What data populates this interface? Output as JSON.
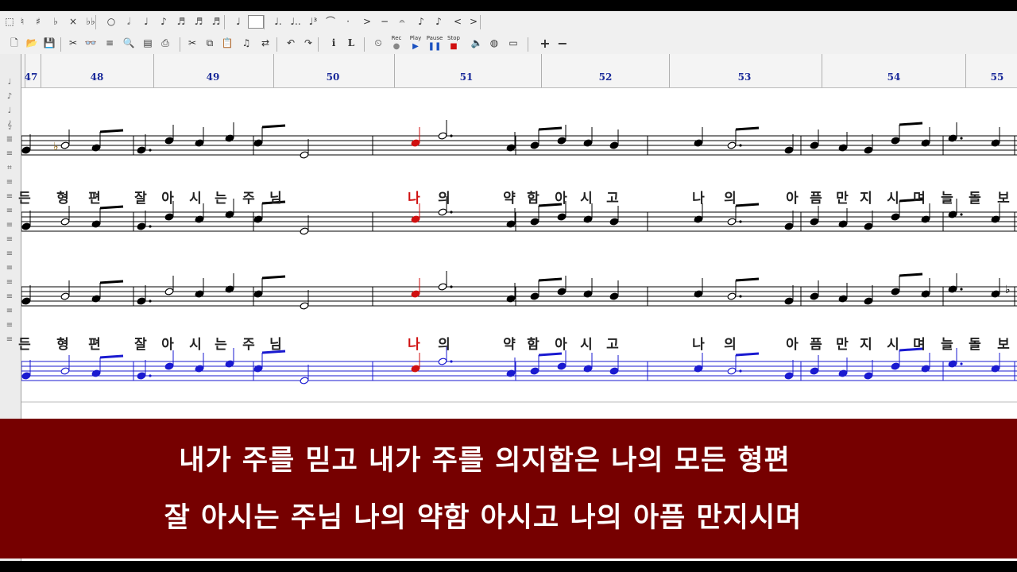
{
  "toolbar_row1": [
    {
      "name": "natural-icon",
      "glyph": "♮"
    },
    {
      "name": "sharp-icon",
      "glyph": "♯"
    },
    {
      "name": "flat-icon",
      "glyph": "♭"
    },
    {
      "name": "double-sharp-icon",
      "glyph": "×"
    },
    {
      "name": "double-flat-icon",
      "glyph": "♭♭"
    },
    {
      "name": "whole-note-icon",
      "glyph": "○"
    },
    {
      "name": "half-note-icon",
      "glyph": "𝅗𝅥"
    },
    {
      "name": "quarter-note-icon",
      "glyph": "♩"
    },
    {
      "name": "eighth-note-icon",
      "glyph": "♪"
    },
    {
      "name": "sixteenth-note-icon",
      "glyph": "♬"
    },
    {
      "name": "thirty-second-note-icon",
      "glyph": "♬"
    },
    {
      "name": "sixty-fourth-note-icon",
      "glyph": "♬"
    },
    {
      "name": "grace-note-icon",
      "glyph": "♩"
    },
    {
      "name": "rest-box-icon",
      "glyph": ""
    },
    {
      "name": "dotted-note-icon",
      "glyph": "♩."
    },
    {
      "name": "double-dotted-note-icon",
      "glyph": "♩.."
    },
    {
      "name": "triplet-icon",
      "glyph": "♩³"
    },
    {
      "name": "tie-icon",
      "glyph": "⌒"
    },
    {
      "name": "staccato-icon",
      "glyph": "·"
    },
    {
      "name": "accent-icon",
      "glyph": ">"
    },
    {
      "name": "tenuto-icon",
      "glyph": "−"
    },
    {
      "name": "fermata-icon",
      "glyph": "𝄐"
    },
    {
      "name": "stem-up-icon",
      "glyph": "♪"
    },
    {
      "name": "stem-down-icon",
      "glyph": "♪"
    },
    {
      "name": "crescendo-icon",
      "glyph": "<"
    },
    {
      "name": "decrescendo-icon",
      "glyph": ">"
    }
  ],
  "toolbar_row2": [
    {
      "name": "new-file-icon",
      "glyph": "🗋"
    },
    {
      "name": "open-file-icon",
      "glyph": "📂"
    },
    {
      "name": "save-icon",
      "glyph": "💾"
    },
    {
      "name": "cut-score-icon",
      "glyph": "✂"
    },
    {
      "name": "glasses-icon",
      "glyph": "👓"
    },
    {
      "name": "edit-staff-icon",
      "glyph": "≡"
    },
    {
      "name": "zoom-icon",
      "glyph": "🔍"
    },
    {
      "name": "print-preview-icon",
      "glyph": "▤"
    },
    {
      "name": "print-icon",
      "glyph": "⎙"
    },
    {
      "name": "cut-icon",
      "glyph": "✂"
    },
    {
      "name": "copy-icon",
      "glyph": "⧉"
    },
    {
      "name": "paste-icon",
      "glyph": "📋"
    },
    {
      "name": "note-input-icon",
      "glyph": "♫"
    },
    {
      "name": "link-icon",
      "glyph": "⇄"
    },
    {
      "name": "undo-icon",
      "glyph": "↶"
    },
    {
      "name": "redo-icon",
      "glyph": "↷"
    },
    {
      "name": "info-icon",
      "glyph": "i"
    },
    {
      "name": "lyrics-icon",
      "glyph": "L"
    },
    {
      "name": "metronome-icon",
      "glyph": "⏲"
    }
  ],
  "transport": {
    "rec_label": "Rec",
    "play_label": "Play",
    "pause_label": "Pause",
    "stop_label": "Stop"
  },
  "toolbar_row2_right": [
    {
      "name": "speaker-icon",
      "glyph": "🔈"
    },
    {
      "name": "globe-icon",
      "glyph": "◍"
    },
    {
      "name": "keyboard-icon",
      "glyph": "▭"
    },
    {
      "name": "zoom-in-icon",
      "glyph": "+"
    },
    {
      "name": "zoom-out-icon",
      "glyph": "−"
    }
  ],
  "measures": {
    "numbers": [
      "47",
      "48",
      "49",
      "50",
      "51",
      "52",
      "53",
      "54",
      "55"
    ]
  },
  "lyrics": {
    "verse1": [
      "든",
      "형",
      "편",
      "잘",
      "아",
      "시",
      "는",
      "주",
      "님",
      "나",
      "의",
      "약",
      "함",
      "아",
      "시",
      "고",
      "나",
      "의",
      "아",
      "픔",
      "만",
      "지",
      "시",
      "며",
      "늘",
      "돌",
      "보"
    ],
    "verse2": [
      "든",
      "형",
      "편",
      "잘",
      "아",
      "시",
      "는",
      "주",
      "님",
      "나",
      "의",
      "약",
      "함",
      "아",
      "시",
      "고",
      "나",
      "의",
      "아",
      "픔",
      "만",
      "지",
      "시",
      "며",
      "늘",
      "돌",
      "보"
    ]
  },
  "subtitle": {
    "line1": "내가 주를 믿고 내가 주를 의지함은 나의 모든 형편",
    "line2": "잘 아시는 주님 나의 약함 아시고 나의 아픔 만지시며"
  },
  "colors": {
    "subtitle_bg": "#760000",
    "subtitle_text": "#ffffff",
    "measure_number": "#1a2a9a",
    "highlight": "#d01010",
    "blue_track": "#1010c8"
  }
}
